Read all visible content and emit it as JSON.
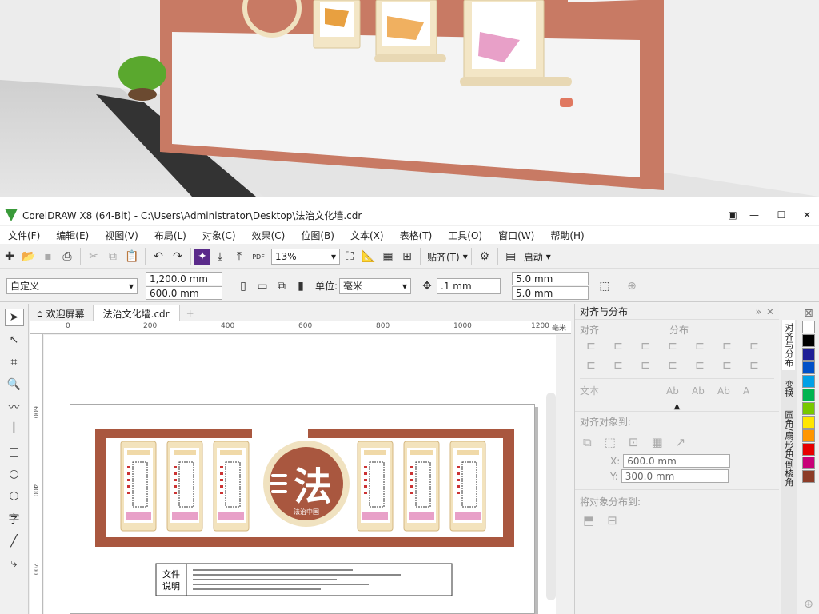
{
  "window": {
    "title": "CorelDRAW X8 (64-Bit) - C:\\Users\\Administrator\\Desktop\\法治文化墙.cdr"
  },
  "menu": [
    "文件(F)",
    "编辑(E)",
    "视图(V)",
    "布局(L)",
    "对象(C)",
    "效果(C)",
    "位图(B)",
    "文本(X)",
    "表格(T)",
    "工具(O)",
    "窗口(W)",
    "帮助(H)"
  ],
  "toolbar": {
    "zoom": "13%",
    "snap_label": "贴齐(T)",
    "launch_label": "启动"
  },
  "propbar": {
    "page_preset": "自定义",
    "width": "1,200.0 mm",
    "height": "600.0 mm",
    "units_label": "单位:",
    "units": "毫米",
    "nudge": ".1 mm",
    "dup_x": "5.0 mm",
    "dup_y": "5.0 mm"
  },
  "tabs": {
    "welcome": "欢迎屏幕",
    "document": "法治文化墙.cdr"
  },
  "ruler": {
    "ticks": [
      "0",
      "200",
      "400",
      "600",
      "800",
      "1000",
      "1200"
    ],
    "unit": "毫米",
    "vticks": [
      "600",
      "400",
      "200"
    ]
  },
  "artwork": {
    "emblem_char": "法",
    "emblem_caption": "法治中国",
    "legend_title_1": "文件",
    "legend_title_2": "说明"
  },
  "docker": {
    "title": "对齐与分布",
    "align_label": "对齐",
    "distribute_label": "分布",
    "text_label": "文本",
    "align_to_label": "对齐对象到:",
    "x_value": "600.0 mm",
    "y_value": "300.0 mm",
    "distribute_to_label": "将对象分布到:",
    "x_prefix": "X:",
    "y_prefix": "Y:"
  },
  "side_tabs": [
    "对齐与分布",
    "变换",
    "圆角/扇形角/倒棱角"
  ],
  "palette": [
    "#ffffff",
    "#000000",
    "#1e1e96",
    "#0050c8",
    "#00a0e6",
    "#00b450",
    "#78c800",
    "#ffe600",
    "#ff9600",
    "#e60000",
    "#c80078",
    "#8c3c28"
  ]
}
